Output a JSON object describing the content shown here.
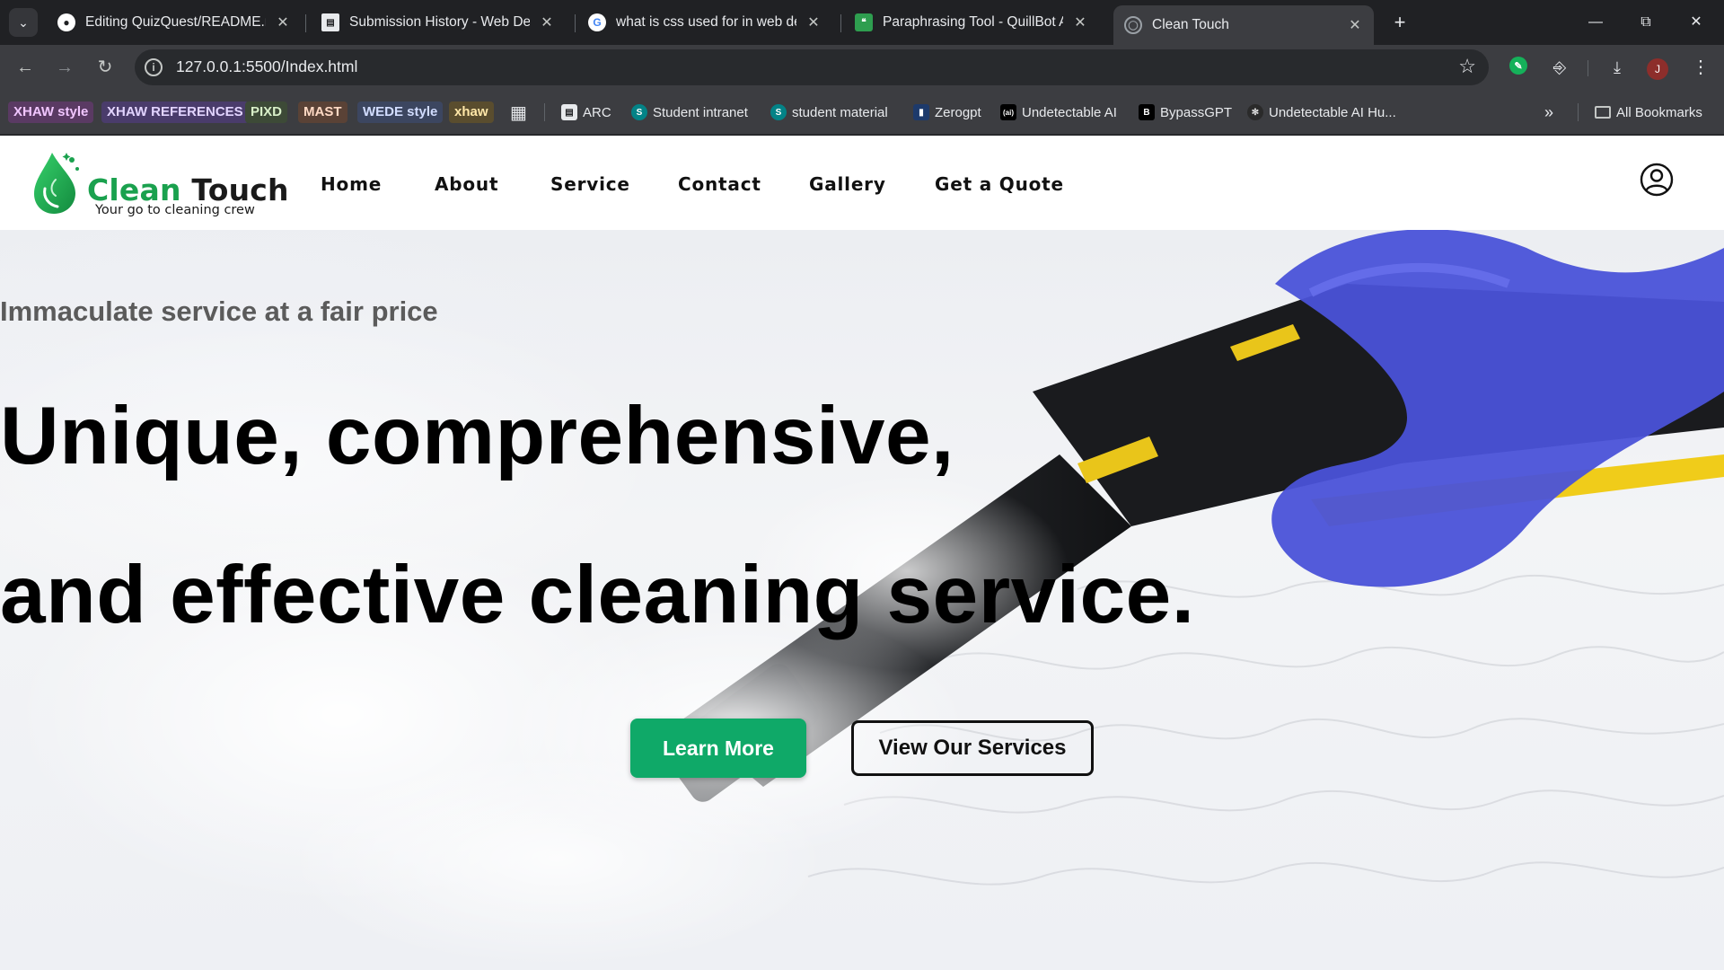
{
  "browser": {
    "tabs": [
      {
        "title": "Editing QuizQuest/README.md",
        "icon": "github-icon"
      },
      {
        "title": "Submission History - Web Deve",
        "icon": "film-icon"
      },
      {
        "title": "what is css used for in web deve",
        "icon": "google-icon"
      },
      {
        "title": "Paraphrasing Tool - QuillBot AI",
        "icon": "quillbot-icon"
      },
      {
        "title": "Clean Touch",
        "icon": "globe-icon"
      }
    ],
    "url": "127.0.0.1:5500/Index.html",
    "profile_initial": "J",
    "bookmarks": {
      "chips": [
        {
          "label": "XHAW style",
          "bg": "#5a3a63",
          "fg": "#f1c6ff"
        },
        {
          "label": "XHAW REFERENCES",
          "bg": "#4a3c6b",
          "fg": "#e2d4ff"
        },
        {
          "label": "PIXD",
          "bg": "#3d4a37",
          "fg": "#d8efc8"
        },
        {
          "label": "MAST",
          "bg": "#5a4236",
          "fg": "#ffd9c4"
        },
        {
          "label": "WEDE style",
          "bg": "#3c4660",
          "fg": "#d2ddff"
        },
        {
          "label": "xhaw",
          "bg": "#5a4d2e",
          "fg": "#ffe7a8"
        }
      ],
      "links": [
        {
          "label": "ARC",
          "icon": "film-icon"
        },
        {
          "label": "Student intranet",
          "icon": "sharepoint-icon"
        },
        {
          "label": "student material",
          "icon": "sharepoint-icon"
        },
        {
          "label": "Zerogpt",
          "icon": "zerogpt-icon"
        },
        {
          "label": "Undetectable AI",
          "icon": "undetectable-icon"
        },
        {
          "label": "BypassGPT",
          "icon": "bypass-icon"
        },
        {
          "label": "Undetectable AI Hu...",
          "icon": "humanizer-icon"
        }
      ],
      "all_bookmarks": "All Bookmarks"
    }
  },
  "site": {
    "brand": {
      "name_part1": "Clean",
      "name_part2": "Touch",
      "tagline": "Your go to cleaning crew"
    },
    "nav": [
      "Home",
      "About",
      "Service",
      "Contact",
      "Gallery",
      "Get a Quote"
    ],
    "hero": {
      "subtitle": "Immaculate service at a fair price",
      "title_line1": "Unique, comprehensive,",
      "title_line2": "and effective cleaning service.",
      "primary_button": "Learn More",
      "secondary_button": "View Our Services"
    },
    "colors": {
      "brand_green": "#1aa14e",
      "button_green": "#0fa968"
    }
  }
}
